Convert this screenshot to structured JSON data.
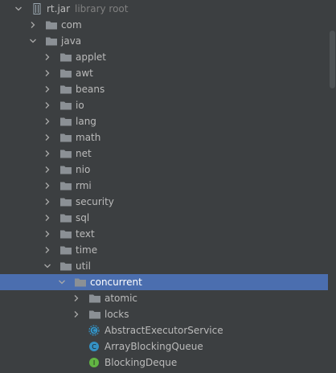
{
  "tree": [
    {
      "label": "rt.jar",
      "suffix": "library root",
      "depth": 0,
      "expanded": true,
      "icon": "jar-icon"
    },
    {
      "label": "com",
      "depth": 1,
      "expanded": false,
      "icon": "folder-icon"
    },
    {
      "label": "java",
      "depth": 1,
      "expanded": true,
      "icon": "folder-icon"
    },
    {
      "label": "applet",
      "depth": 2,
      "expanded": false,
      "icon": "folder-icon"
    },
    {
      "label": "awt",
      "depth": 2,
      "expanded": false,
      "icon": "folder-icon"
    },
    {
      "label": "beans",
      "depth": 2,
      "expanded": false,
      "icon": "folder-icon"
    },
    {
      "label": "io",
      "depth": 2,
      "expanded": false,
      "icon": "folder-icon"
    },
    {
      "label": "lang",
      "depth": 2,
      "expanded": false,
      "icon": "folder-icon"
    },
    {
      "label": "math",
      "depth": 2,
      "expanded": false,
      "icon": "folder-icon"
    },
    {
      "label": "net",
      "depth": 2,
      "expanded": false,
      "icon": "folder-icon"
    },
    {
      "label": "nio",
      "depth": 2,
      "expanded": false,
      "icon": "folder-icon"
    },
    {
      "label": "rmi",
      "depth": 2,
      "expanded": false,
      "icon": "folder-icon"
    },
    {
      "label": "security",
      "depth": 2,
      "expanded": false,
      "icon": "folder-icon"
    },
    {
      "label": "sql",
      "depth": 2,
      "expanded": false,
      "icon": "folder-icon"
    },
    {
      "label": "text",
      "depth": 2,
      "expanded": false,
      "icon": "folder-icon"
    },
    {
      "label": "time",
      "depth": 2,
      "expanded": false,
      "icon": "folder-icon"
    },
    {
      "label": "util",
      "depth": 2,
      "expanded": true,
      "icon": "folder-icon"
    },
    {
      "label": "concurrent",
      "depth": 3,
      "expanded": true,
      "icon": "folder-icon",
      "selected": true
    },
    {
      "label": "atomic",
      "depth": 4,
      "expanded": false,
      "icon": "folder-icon"
    },
    {
      "label": "locks",
      "depth": 4,
      "expanded": false,
      "icon": "folder-icon"
    },
    {
      "label": "AbstractExecutorService",
      "depth": 4,
      "icon": "abstract-class-icon"
    },
    {
      "label": "ArrayBlockingQueue",
      "depth": 4,
      "icon": "class-icon"
    },
    {
      "label": "BlockingDeque",
      "depth": 4,
      "icon": "interface-icon"
    }
  ],
  "colors": {
    "background": "#3c3f41",
    "selection": "#4b6eaf",
    "text": "#bbbbbb",
    "muted": "#808080",
    "folder": "#8b9095",
    "class": "#3592c4",
    "interface": "#62b543"
  }
}
